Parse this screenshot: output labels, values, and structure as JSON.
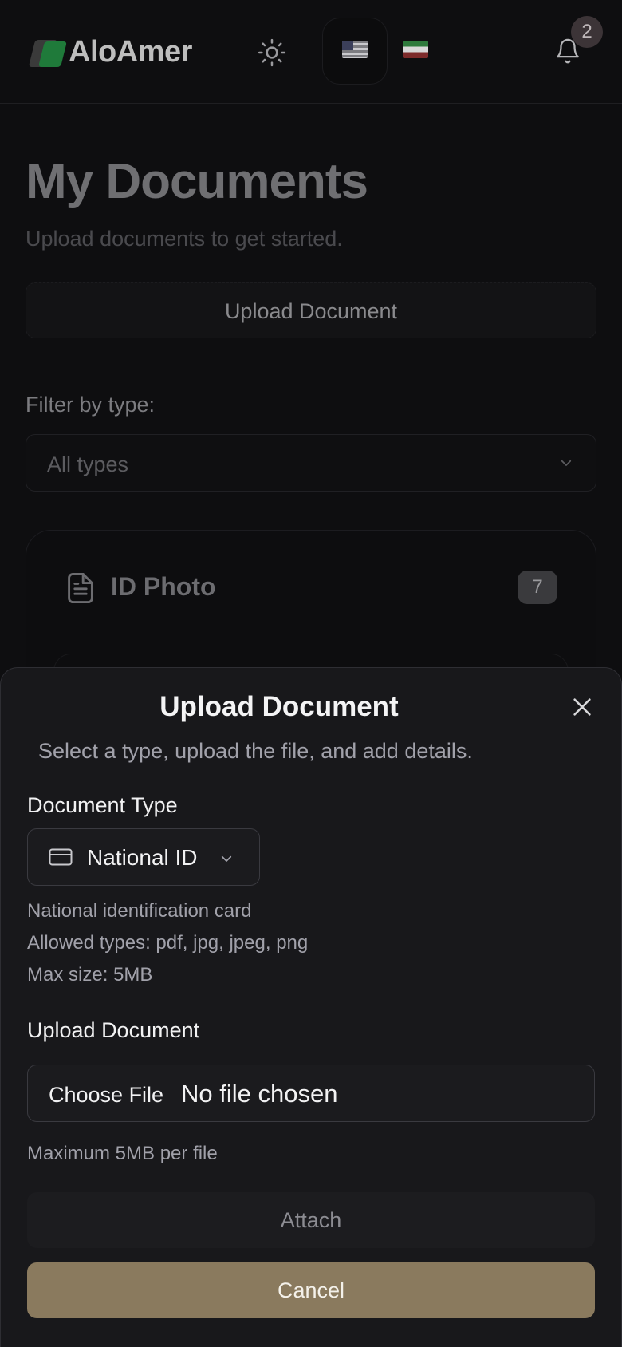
{
  "header": {
    "brand": "AloAmer",
    "notification_count": "2",
    "icons": [
      "sun-icon",
      "us-flag-icon",
      "iran-flag-icon",
      "bell-icon"
    ]
  },
  "page": {
    "title": "My Documents",
    "subtitle": "Upload documents to get started.",
    "upload_button": "Upload Document",
    "filter_label": "Filter by type:",
    "filter_value": "All types",
    "card": {
      "title": "ID Photo",
      "count": "7"
    }
  },
  "dialog": {
    "title": "Upload Document",
    "description": "Select a type, upload the file, and add details.",
    "document_type_label": "Document Type",
    "document_type_value": "National ID",
    "type_description": "National identification card",
    "allowed_types": "Allowed types: pdf, jpg, jpeg, png",
    "max_size": "Max size: 5MB",
    "upload_label": "Upload Document",
    "choose_file": "Choose File",
    "no_file": "No file chosen",
    "file_hint": "Maximum 5MB per file",
    "attach": "Attach",
    "cancel": "Cancel"
  },
  "colors": {
    "accent": "#8a7a5e",
    "sheet_bg": "#18181b",
    "page_bg": "#0e0e10"
  }
}
